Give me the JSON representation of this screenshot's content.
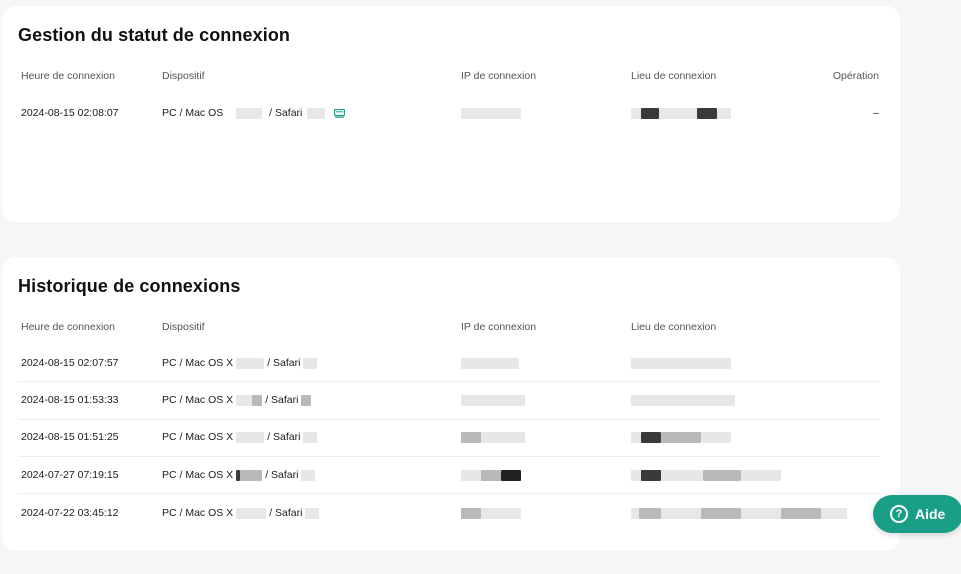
{
  "status": {
    "title": "Gestion du statut de connexion",
    "headers": {
      "time": "Heure de connexion",
      "device": "Dispositif",
      "ip": "IP de connexion",
      "location": "Lieu de connexion",
      "operation": "Opération"
    },
    "rows": [
      {
        "time": "2024-08-15 02:08:07",
        "device_a": "PC / Mac OS",
        "device_b": "/ Safari",
        "operation": "–"
      }
    ]
  },
  "history": {
    "title": "Historique de connexions",
    "headers": {
      "time": "Heure de connexion",
      "device": "Dispositif",
      "ip": "IP de connexion",
      "location": "Lieu de connexion"
    },
    "rows": [
      {
        "time": "2024-08-15 02:07:57",
        "device_a": "PC / Mac OS X",
        "device_b": "/ Safari"
      },
      {
        "time": "2024-08-15 01:53:33",
        "device_a": "PC / Mac OS X",
        "device_b": "/ Safari"
      },
      {
        "time": "2024-08-15 01:51:25",
        "device_a": "PC / Mac OS X",
        "device_b": "/ Safari"
      },
      {
        "time": "2024-07-27 07:19:15",
        "device_a": "PC / Mac OS X",
        "device_b": "/ Safari"
      },
      {
        "time": "2024-07-22 03:45:12",
        "device_a": "PC / Mac OS X",
        "device_b": "/ Safari"
      }
    ]
  },
  "help": {
    "label": "Aide",
    "icon": "question-circle-icon"
  },
  "colors": {
    "accent": "#1a9f87",
    "card": "#ffffff",
    "background": "#f6f6f7"
  }
}
